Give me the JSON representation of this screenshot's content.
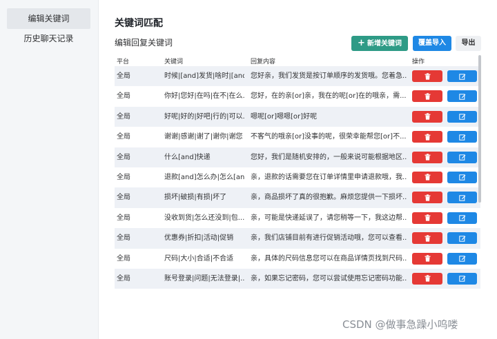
{
  "sidebar": {
    "items": [
      {
        "label": "编辑关键词",
        "active": true
      },
      {
        "label": "历史聊天记录",
        "active": false
      }
    ]
  },
  "main": {
    "title": "关键词匹配",
    "subtitle": "编辑回复关键词",
    "buttons": {
      "add_icon": "+",
      "add_label": "新增关键词",
      "import_label": "覆盖导入",
      "export_label": "导出"
    },
    "table": {
      "headers": {
        "platform": "平台",
        "keyword": "关键词",
        "reply": "回复内容",
        "actions": "操作"
      },
      "rows": [
        {
          "platform": "全局",
          "keyword": "时候|[and]发货|啥时|[and]...",
          "reply": "您好亲，我们发货是按订单顺序的发货哦。您着急..."
        },
        {
          "platform": "全局",
          "keyword": "你好|您好|在吗|在不|在么...",
          "reply": "您好，在的亲[or]亲，我在的呢[or]在的哦亲，需..."
        },
        {
          "platform": "全局",
          "keyword": "好呢|好的|好吧|行的|可以...",
          "reply": "嗯呢[or]嗯嗯[or]好呢"
        },
        {
          "platform": "全局",
          "keyword": "谢谢|感谢|谢了|谢你|谢您",
          "reply": "不客气的哦亲[or]没事的呢，很荣幸能帮您[or]不..."
        },
        {
          "platform": "全局",
          "keyword": "什么[and]快递",
          "reply": "您好，我们是随机安排的，一般来说可能根据地区..."
        },
        {
          "platform": "全局",
          "keyword": "退款[and]怎么办|怎么[an...",
          "reply": "亲，退款的话需要您在订单详情里申请退款哦，我..."
        },
        {
          "platform": "全局",
          "keyword": "损坏|破损|有损|坏了",
          "reply": "亲，商品损坏了真的很抱歉。麻烦您提供一下损坏..."
        },
        {
          "platform": "全局",
          "keyword": "没收到货|怎么还没到|包...",
          "reply": "亲，可能是快递延误了，请您稍等一下，我这边帮..."
        },
        {
          "platform": "全局",
          "keyword": "优惠券|折扣|活动|促销",
          "reply": "亲，我们店铺目前有进行促销活动哦，您可以查看..."
        },
        {
          "platform": "全局",
          "keyword": "尺码|大小|合适|不合适",
          "reply": "亲，具体的尺码信息您可以在商品详情页找到尺码..."
        },
        {
          "platform": "全局",
          "keyword": "账号登录|问题|无法登录|...",
          "reply": "亲，如果忘记密码，您可以尝试使用忘记密码功能..."
        }
      ],
      "row_actions": {
        "delete_icon": "trash-icon",
        "edit_icon": "edit-icon"
      }
    }
  },
  "watermark": "CSDN @做事急躁小呜喽",
  "colors": {
    "add": "#2e9b86",
    "import": "#1e88e5",
    "delete": "#e53935",
    "edit": "#1e88e5",
    "stripe": "#eef1f6"
  }
}
